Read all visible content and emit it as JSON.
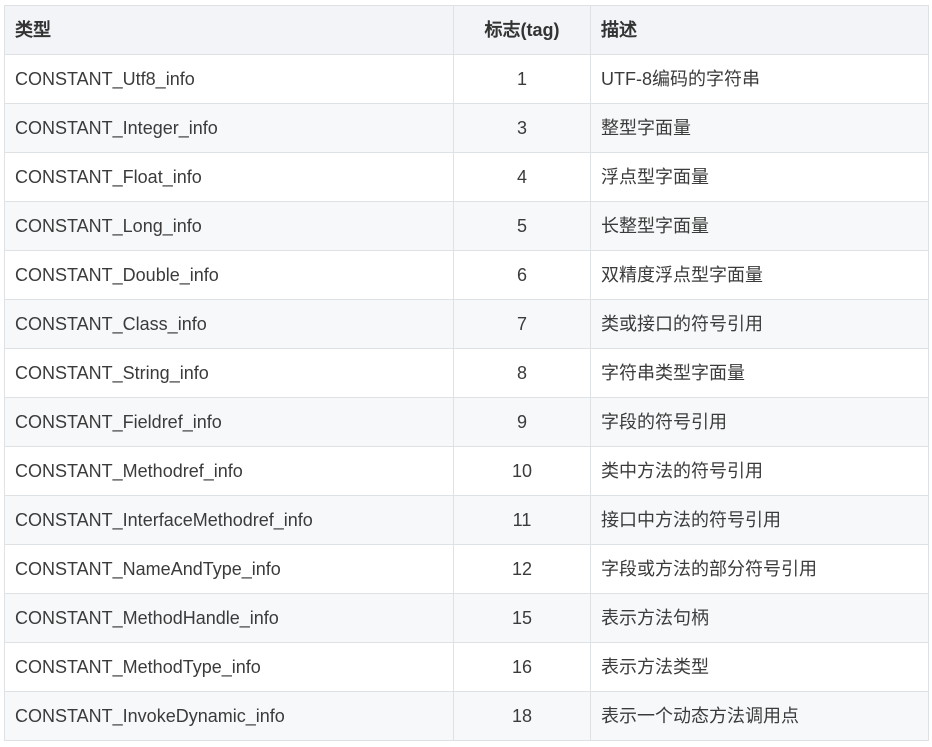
{
  "table": {
    "headers": [
      "类型",
      "标志(tag)",
      "描述"
    ],
    "rows": [
      [
        "CONSTANT_Utf8_info",
        "1",
        "UTF-8编码的字符串"
      ],
      [
        "CONSTANT_Integer_info",
        "3",
        "整型字面量"
      ],
      [
        "CONSTANT_Float_info",
        "4",
        "浮点型字面量"
      ],
      [
        "CONSTANT_Long_info",
        "5",
        "长整型字面量"
      ],
      [
        "CONSTANT_Double_info",
        "6",
        "双精度浮点型字面量"
      ],
      [
        "CONSTANT_Class_info",
        "7",
        "类或接口的符号引用"
      ],
      [
        "CONSTANT_String_info",
        "8",
        "字符串类型字面量"
      ],
      [
        "CONSTANT_Fieldref_info",
        "9",
        "字段的符号引用"
      ],
      [
        "CONSTANT_Methodref_info",
        "10",
        "类中方法的符号引用"
      ],
      [
        "CONSTANT_InterfaceMethodref_info",
        "11",
        "接口中方法的符号引用"
      ],
      [
        "CONSTANT_NameAndType_info",
        "12",
        "字段或方法的部分符号引用"
      ],
      [
        "CONSTANT_MethodHandle_info",
        "15",
        "表示方法句柄"
      ],
      [
        "CONSTANT_MethodType_info",
        "16",
        "表示方法类型"
      ],
      [
        "CONSTANT_InvokeDynamic_info",
        "18",
        "表示一个动态方法调用点"
      ]
    ]
  }
}
